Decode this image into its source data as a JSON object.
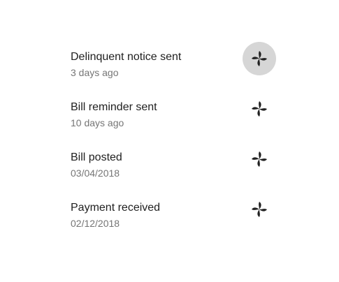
{
  "items": [
    {
      "title": "Delinquent notice sent",
      "subtitle": "3 days ago",
      "icon": "pinwheel-icon",
      "focused": true
    },
    {
      "title": "Bill reminder sent",
      "subtitle": "10 days ago",
      "icon": "pinwheel-icon",
      "focused": false
    },
    {
      "title": "Bill posted",
      "subtitle": "03/04/2018",
      "icon": "pinwheel-icon",
      "focused": false
    },
    {
      "title": "Payment received",
      "subtitle": "02/12/2018",
      "icon": "pinwheel-icon",
      "focused": false
    }
  ],
  "colors": {
    "primary_text": "#212121",
    "secondary_text": "#757575",
    "icon": "#212121",
    "focus_ring": "#d6d6d6"
  }
}
